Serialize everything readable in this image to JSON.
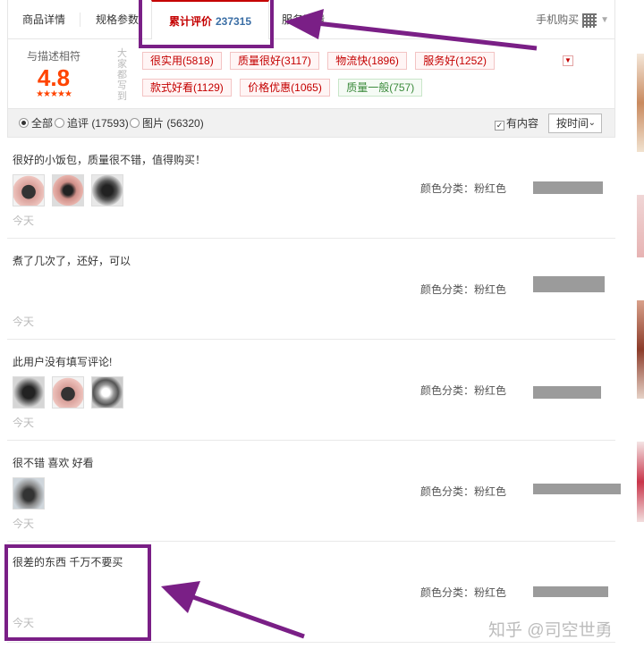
{
  "tabs": {
    "details": "商品详情",
    "specs": "规格参数",
    "reviews_label": "累计评价",
    "reviews_count": "237315",
    "service": "服务详情",
    "mobile_buy": "手机购买"
  },
  "summary": {
    "rating_label": "与描述相符",
    "score": "4.8",
    "stars": "★★★★★",
    "vertical_label": "大家都写到",
    "tags": [
      "很实用(5818)",
      "质量很好(3117)",
      "物流快(1896)",
      "服务好(1252)",
      "款式好看(1129)",
      "价格优惠(1065)",
      "质量一般(757)"
    ]
  },
  "filters": {
    "all": "全部",
    "followup": "追评 (17593)",
    "images": "图片 (56320)",
    "has_content": "有内容",
    "sort": "按时间"
  },
  "reviews": [
    {
      "text": "很好的小饭包，质量很不错，值得购买！",
      "date": "今天",
      "color": "颜色分类：粉红色"
    },
    {
      "text": "煮了几次了，还好，可以",
      "date": "今天",
      "color": "颜色分类：粉红色"
    },
    {
      "text": "此用户没有填写评论!",
      "date": "今天",
      "color": "颜色分类：粉红色"
    },
    {
      "text": "很不错 喜欢 好看",
      "date": "今天",
      "color": "颜色分类：粉红色"
    },
    {
      "text": "很差的东西 千万不要买",
      "date": "今天",
      "color": "颜色分类：粉红色"
    }
  ],
  "watermark": "知乎 @司空世勇",
  "colors": {
    "accent_red": "#c40000",
    "score_orange": "#ff4400",
    "annotation_purple": "#7a1f86",
    "link_blue": "#3a6ea5"
  },
  "icons": [
    "qr-code-icon",
    "dropdown-caret-icon",
    "expand-tags-icon",
    "radio-icon",
    "checkbox-icon",
    "chevron-down-icon"
  ]
}
